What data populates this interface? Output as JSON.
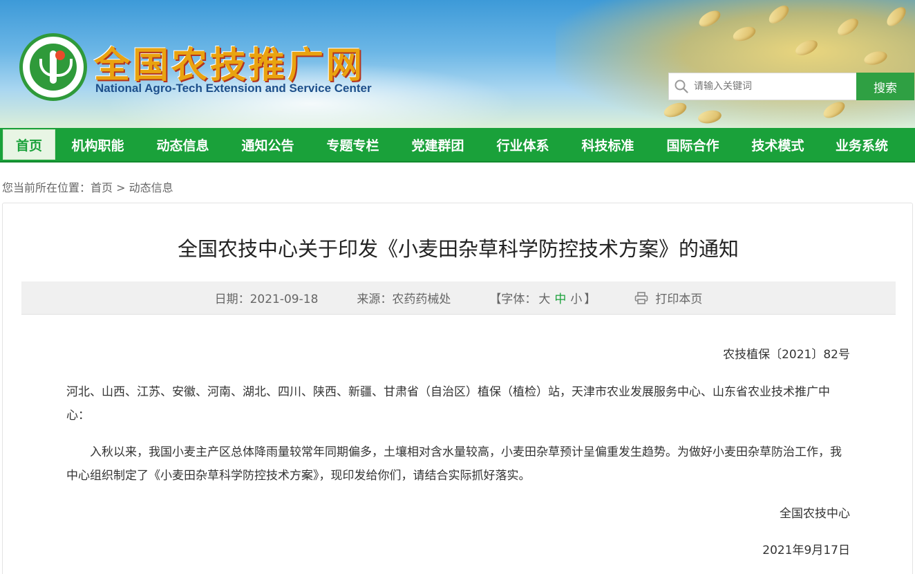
{
  "header": {
    "logo_title": "全国农技推广网",
    "logo_subtitle": "National Agro-Tech Extension and Service Center",
    "emblem_icon": "natesc-logo-icon"
  },
  "search": {
    "placeholder": "请输入关键词",
    "button_label": "搜索",
    "icon": "search-icon"
  },
  "nav": {
    "items": [
      {
        "label": "首页",
        "active": true
      },
      {
        "label": "机构职能"
      },
      {
        "label": "动态信息"
      },
      {
        "label": "通知公告"
      },
      {
        "label": "专题专栏"
      },
      {
        "label": "党建群团"
      },
      {
        "label": "行业体系"
      },
      {
        "label": "科技标准"
      },
      {
        "label": "国际合作"
      },
      {
        "label": "技术模式"
      },
      {
        "label": "业务系统"
      }
    ]
  },
  "breadcrumb": {
    "prefix": "您当前所在位置：",
    "home": "首页",
    "sep": ">",
    "current": "动态信息"
  },
  "article": {
    "title": "全国农技中心关于印发《小麦田杂草科学防控技术方案》的通知",
    "meta": {
      "date_label": "日期：2021-09-18",
      "source_label": "来源：农药药械处",
      "font_open": "【字体：",
      "font_large": "大",
      "font_medium": "中",
      "font_small": "小",
      "font_close": "】",
      "print_label": "打印本页",
      "print_icon": "printer-icon"
    },
    "doc_number": "农技植保〔2021〕82号",
    "recipients": "河北、山西、江苏、安徽、河南、湖北、四川、陕西、新疆、甘肃省（自治区）植保（植检）站，天津市农业发展服务中心、山东省农业技术推广中心：",
    "paragraph": "入秋以来，我国小麦主产区总体降雨量较常年同期偏多，土壤相对含水量较高，小麦田杂草预计呈偏重发生趋势。为做好小麦田杂草防治工作，我中心组织制定了《小麦田杂草科学防控技术方案》，现印发给你们，请结合实际抓好落实。",
    "signer": "全国农技中心",
    "sign_date": "2021年9月17日"
  },
  "colors": {
    "nav_green": "#1aa13a",
    "logo_orange": "#e9a310",
    "subtitle_blue": "#1d4f8a"
  }
}
